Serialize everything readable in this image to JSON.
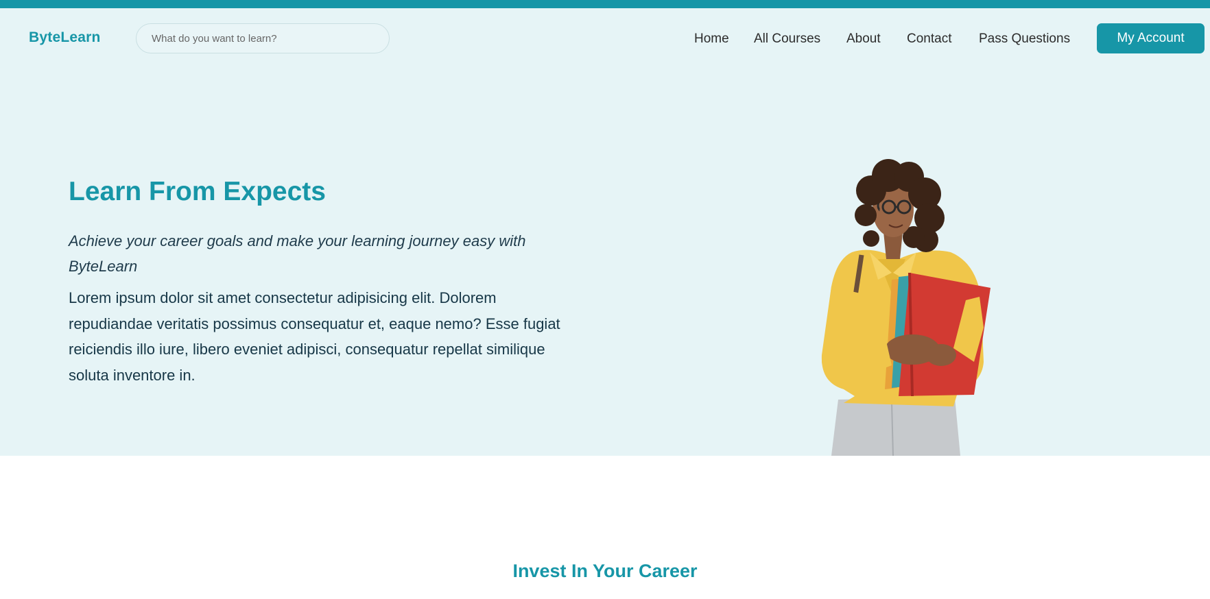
{
  "header": {
    "brand": "ByteLearn",
    "search_placeholder": "What do you want to learn?",
    "nav": {
      "home": "Home",
      "all_courses": "All Courses",
      "about": "About",
      "contact": "Contact",
      "pass_questions": "Pass Questions"
    },
    "account_button": "My Account"
  },
  "hero": {
    "title": "Learn From Expects",
    "tagline": "Achieve your career goals and make your learning journey easy with ByteLearn",
    "body": "Lorem ipsum dolor sit amet consectetur adipisicing elit. Dolorem repudiandae veritatis possimus consequatur et, eaque nemo? Esse fugiat reiciendis illo iure, libero eveniet adipisci, consequatur repellat similique soluta inventore in."
  },
  "section": {
    "title": "Invest In Your Career"
  },
  "colors": {
    "accent": "#1796a7",
    "hero_background": "#e6f4f6",
    "text_dark": "#173747"
  }
}
